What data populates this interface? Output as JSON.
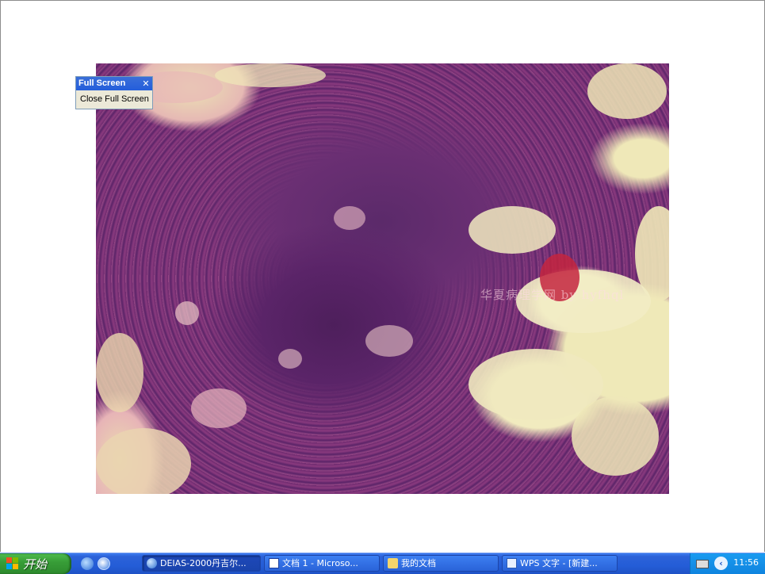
{
  "fullscreen_toolbar": {
    "title": "Full Screen",
    "close_glyph": "✕",
    "close_button_label": "Close Full Screen"
  },
  "image": {
    "watermark": "华夏病理学网 by hyfhql"
  },
  "taskbar": {
    "start_label": "开始",
    "quick_launch": [
      "ie-icon",
      "ie-browser-icon"
    ],
    "tasks": [
      {
        "label": "DEIAS-2000丹吉尔...",
        "icon": "globe-icon",
        "active": true
      },
      {
        "label": "文档 1 - Microso...",
        "icon": "word-icon",
        "active": false
      },
      {
        "label": "我的文档",
        "icon": "folder-icon",
        "active": false
      },
      {
        "label": "WPS 文字 - [新建...",
        "icon": "wps-icon",
        "active": false
      }
    ],
    "clock": "11:56"
  },
  "colors": {
    "taskbar_blue": "#245dd7",
    "start_green": "#389e38",
    "tray_blue": "#0f84df"
  }
}
